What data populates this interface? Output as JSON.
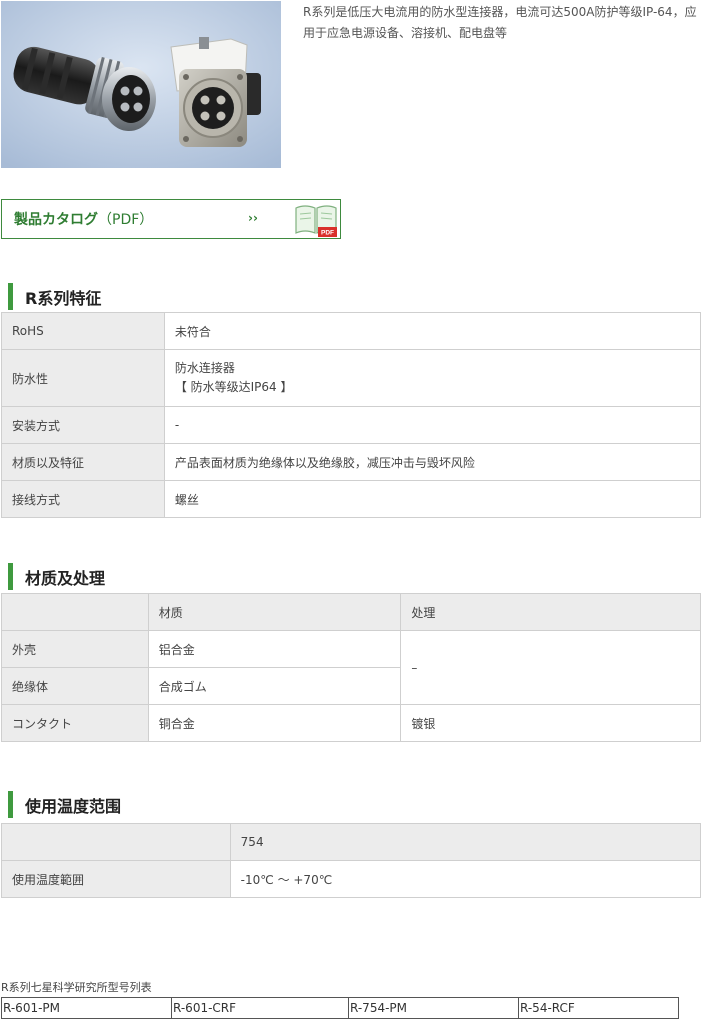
{
  "intro": {
    "text": "R系列是低压大电流用的防水型连接器，电流可达500A防护等级IP-64，应用于应急电源设备、溶接机、配电盘等"
  },
  "catalog_button": {
    "label_main": "製品カタログ",
    "label_suffix": "（PDF）",
    "arrow": "››",
    "pdf_badge": "PDF"
  },
  "features": {
    "heading": "R系列特征",
    "rows": [
      {
        "label": "RoHS",
        "value": "未符合"
      },
      {
        "label": "防水性",
        "value_line1": "防水连接器",
        "value_line2": "【 防水等级达IP64 】"
      },
      {
        "label": "安装方式",
        "value": "-"
      },
      {
        "label": "材质以及特征",
        "value": "产品表面材质为绝缘体以及绝缘胶，减压冲击与毁坏风险"
      },
      {
        "label": "接线方式",
        "value": "螺丝"
      }
    ]
  },
  "materials": {
    "heading": "材质及处理",
    "col_material": "材质",
    "col_treatment": "处理",
    "rows": [
      {
        "part": "外壳",
        "material": "铝合金"
      },
      {
        "part": "绝缘体",
        "material": "合成ゴム"
      },
      {
        "part": "コンタクト",
        "material": "铜合金",
        "treatment": "镀银"
      }
    ],
    "merged_treatment": "–"
  },
  "temperature": {
    "heading": "使用温度范围",
    "col_model": "754",
    "row_label": "使用温度範囲",
    "row_value": "-10℃ ～ +70℃"
  },
  "models": {
    "caption": "R系列七星科学研究所型号列表",
    "items": [
      "R-601-PM",
      "R-601-CRF",
      "R-754-PM",
      "R-54-RCF"
    ]
  },
  "colors": {
    "accent_green": "#3f9a3f",
    "table_header_gray": "#ececec",
    "border_gray": "#cfcfcf"
  }
}
